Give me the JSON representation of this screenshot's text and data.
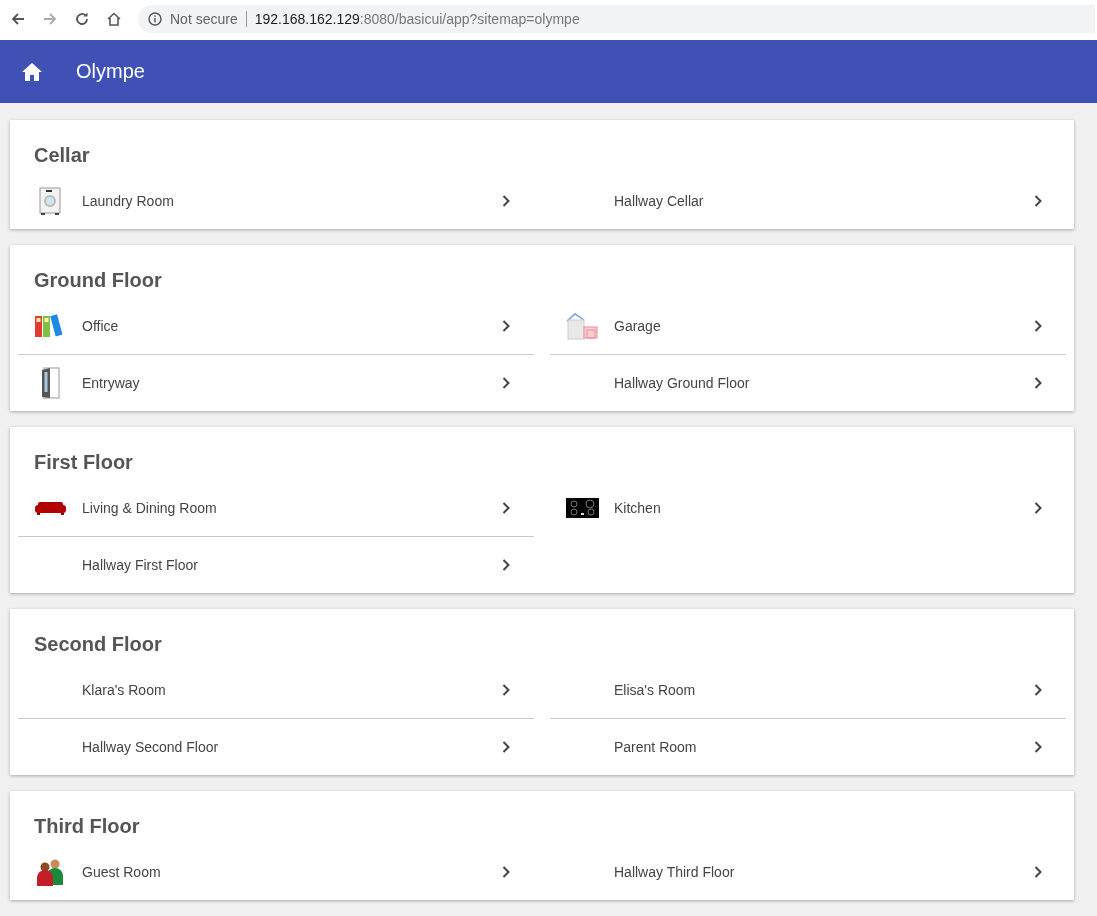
{
  "browser": {
    "security": "Not secure",
    "url_host": "192.168.162.129",
    "url_rest": ":8080/basicui/app?sitemap=olympe"
  },
  "header": {
    "title": "Olympe"
  },
  "sections": [
    {
      "title": "Cellar",
      "items": [
        {
          "label": "Laundry Room",
          "kind": "washer"
        },
        {
          "label": "Hallway Cellar",
          "kind": "none"
        }
      ]
    },
    {
      "title": "Ground Floor",
      "items": [
        {
          "label": "Office",
          "kind": "binders"
        },
        {
          "label": "Garage",
          "kind": "garage"
        },
        {
          "label": "Entryway",
          "kind": "door"
        },
        {
          "label": "Hallway Ground Floor",
          "kind": "none"
        }
      ]
    },
    {
      "title": "First Floor",
      "items": [
        {
          "label": "Living & Dining Room",
          "kind": "sofa"
        },
        {
          "label": "Kitchen",
          "kind": "cooktop"
        },
        {
          "label": "Hallway First Floor",
          "kind": "none"
        }
      ]
    },
    {
      "title": "Second Floor",
      "items": [
        {
          "label": "Klara's Room",
          "kind": "none"
        },
        {
          "label": "Elisa's Room",
          "kind": "none"
        },
        {
          "label": "Hallway Second Floor",
          "kind": "none"
        },
        {
          "label": "Parent Room",
          "kind": "none"
        }
      ]
    },
    {
      "title": "Third Floor",
      "items": [
        {
          "label": "Guest Room",
          "kind": "people"
        },
        {
          "label": "Hallway Third Floor",
          "kind": "none"
        }
      ]
    }
  ]
}
